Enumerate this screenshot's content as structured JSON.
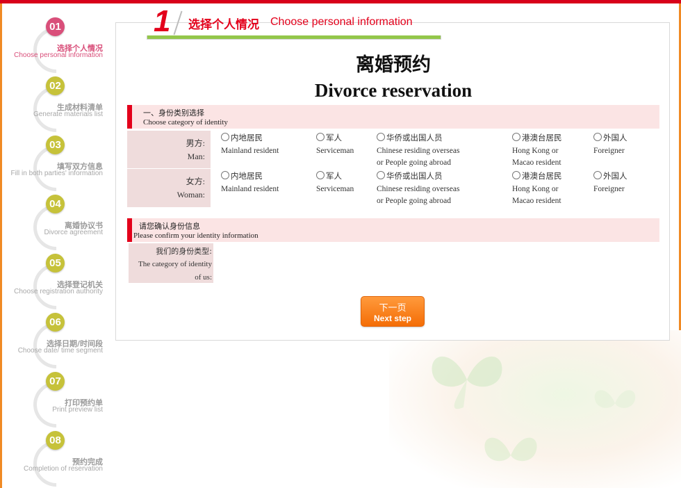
{
  "colors": {
    "accent": "#e3001b",
    "step_active": "#d94f7a",
    "step_inactive": "#c6c23a",
    "button": "#f46d06"
  },
  "steps": [
    {
      "num": "01",
      "cn": "选择个人情况",
      "en": "Choose personal information",
      "state": "active"
    },
    {
      "num": "02",
      "cn": "生成材料清单",
      "en": "Generate materials list",
      "state": "inactive"
    },
    {
      "num": "03",
      "cn": "填写双方信息",
      "en": "Fill in both parties' information",
      "state": "inactive"
    },
    {
      "num": "04",
      "cn": "离婚协议书",
      "en": "Divorce agreement",
      "state": "inactive"
    },
    {
      "num": "05",
      "cn": "选择登记机关",
      "en": "Choose registration authority",
      "state": "inactive"
    },
    {
      "num": "06",
      "cn": "选择日期/时间段",
      "en": "Choose date/ time segment",
      "state": "inactive"
    },
    {
      "num": "07",
      "cn": "打印预约单",
      "en": "Print preview list",
      "state": "inactive"
    },
    {
      "num": "08",
      "cn": "预约完成",
      "en": "Completion of reservation",
      "state": "inactive"
    }
  ],
  "header": {
    "step_number": "1",
    "cn": "选择个人情况",
    "en": "Choose personal information"
  },
  "title": {
    "cn": "离婚预约",
    "en": "Divorce reservation"
  },
  "section1": {
    "cn": "一、身份类别选择",
    "en": "Choose category of identity"
  },
  "identity_rows": [
    {
      "label_cn": "男方:",
      "label_en": "Man:"
    },
    {
      "label_cn": "女方:",
      "label_en": "Woman:"
    }
  ],
  "options": [
    {
      "cn": "内地居民",
      "en1": "Mainland resident",
      "en2": ""
    },
    {
      "cn": "军人",
      "en1": "Serviceman",
      "en2": ""
    },
    {
      "cn": "华侨或出国人员",
      "en1": "Chinese residing overseas",
      "en2": "or People going abroad"
    },
    {
      "cn": "港澳台居民",
      "en1": "Hong Kong or",
      "en2": "Macao resident"
    },
    {
      "cn": "外国人",
      "en1": "Foreigner",
      "en2": ""
    }
  ],
  "section2": {
    "cn": "请您确认身份信息",
    "en": "Please confirm your identity information"
  },
  "confirm": {
    "cn": "我们的身份类型:",
    "en1": "The category of identity",
    "en2": "of us:"
  },
  "next_button": {
    "cn": "下一页",
    "en": "Next step"
  }
}
